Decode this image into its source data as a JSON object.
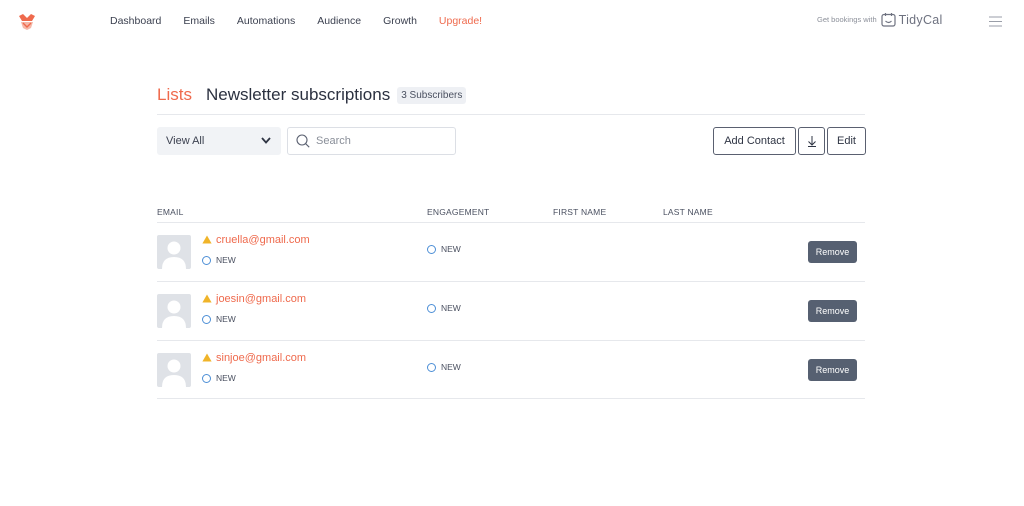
{
  "nav": {
    "items": [
      "Dashboard",
      "Emails",
      "Automations",
      "Audience",
      "Growth"
    ],
    "upgrade_label": "Upgrade!",
    "promo_text": "Get bookings with",
    "promo_brand": "TidyCal"
  },
  "header": {
    "breadcrumb": "Lists",
    "title": "Newsletter subscriptions",
    "subscriber_count": "3 Subscribers"
  },
  "toolbar": {
    "filter_value": "View All",
    "search_placeholder": "Search",
    "add_contact_label": "Add Contact",
    "edit_label": "Edit"
  },
  "table": {
    "columns": [
      "EMAIL",
      "ENGAGEMENT",
      "FIRST NAME",
      "LAST NAME"
    ],
    "rows": [
      {
        "email": "cruella@gmail.com",
        "status": "NEW",
        "engagement": "NEW",
        "first_name": "",
        "last_name": "",
        "action": "Remove"
      },
      {
        "email": "joesin@gmail.com",
        "status": "NEW",
        "engagement": "NEW",
        "first_name": "",
        "last_name": "",
        "action": "Remove"
      },
      {
        "email": "sinjoe@gmail.com",
        "status": "NEW",
        "engagement": "NEW",
        "first_name": "",
        "last_name": "",
        "action": "Remove"
      }
    ]
  },
  "colors": {
    "accent": "#ef6a4d",
    "warning": "#f0b429",
    "status_circle": "#4d8fd6",
    "remove_button": "#566071"
  },
  "icons": {
    "logo": "emailoctopus-logo-icon",
    "menu": "hamburger-menu-icon",
    "search": "search-icon",
    "dropdown": "chevron-down-icon",
    "download": "download-icon",
    "warning": "warning-triangle-icon",
    "avatar": "user-avatar-icon"
  }
}
